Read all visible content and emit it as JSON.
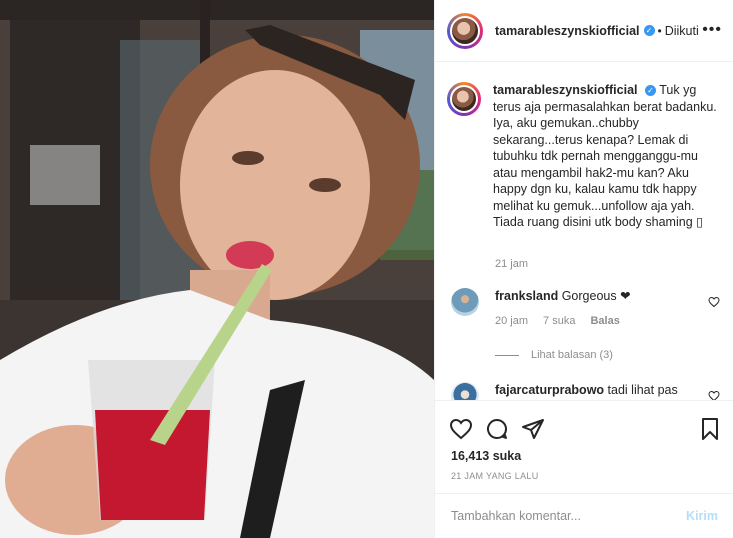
{
  "post": {
    "username": "tamarableszynskiofficial",
    "follow_separator": "•",
    "follow_state": "Diikuti",
    "more_icon": "more-horizontal-icon"
  },
  "caption": {
    "username": "tamarableszynskiofficial",
    "text": "Tuk yg terus aja permasalahkan berat badanku. Iya, aku gemukan..chubby sekarang...terus kenapa? Lemak di tubuhku tdk pernah mengganggu-mu atau mengambil hak2-mu kan? Aku happy dgn ku, kalau kamu tdk happy melihat ku gemuk...unfollow aja yah. Tiada ruang disini utk body shaming",
    "trailing_glyph": "▯",
    "time": "21 jam"
  },
  "comments": [
    {
      "username": "franksland",
      "text": "Gorgeous ❤",
      "time": "20 jam",
      "likes": "7 suka",
      "reply": "Balas"
    },
    {
      "username": "fajarcaturprabowo",
      "text": "tadi lihat pas"
    }
  ],
  "view_replies": "Lihat balasan (3)",
  "likes": "16,413 suka",
  "post_time": "21 JAM YANG LALU",
  "add_comment": {
    "placeholder": "Tambahkan komentar...",
    "post_label": "Kirim"
  },
  "colors": {
    "link_blue": "#3897f0",
    "post_disabled": "#b2dffc",
    "muted": "#8e8e8e"
  }
}
